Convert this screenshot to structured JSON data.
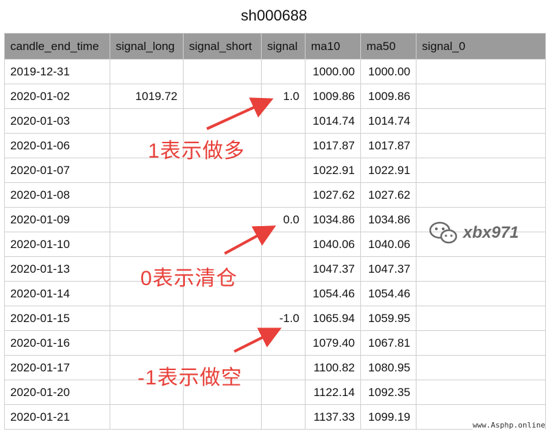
{
  "title": "sh000688",
  "columns": [
    "candle_end_time",
    "signal_long",
    "signal_short",
    "signal",
    "ma10",
    "ma50",
    "signal_0"
  ],
  "rows": [
    [
      "2019-12-31",
      "",
      "",
      "",
      "1000.00",
      "1000.00",
      ""
    ],
    [
      "2020-01-02",
      "1019.72",
      "",
      "1.0",
      "1009.86",
      "1009.86",
      ""
    ],
    [
      "2020-01-03",
      "",
      "",
      "",
      "1014.74",
      "1014.74",
      ""
    ],
    [
      "2020-01-06",
      "",
      "",
      "",
      "1017.87",
      "1017.87",
      ""
    ],
    [
      "2020-01-07",
      "",
      "",
      "",
      "1022.91",
      "1022.91",
      ""
    ],
    [
      "2020-01-08",
      "",
      "",
      "",
      "1027.62",
      "1027.62",
      ""
    ],
    [
      "2020-01-09",
      "",
      "",
      "0.0",
      "1034.86",
      "1034.86",
      ""
    ],
    [
      "2020-01-10",
      "",
      "",
      "",
      "1040.06",
      "1040.06",
      ""
    ],
    [
      "2020-01-13",
      "",
      "",
      "",
      "1047.37",
      "1047.37",
      ""
    ],
    [
      "2020-01-14",
      "",
      "",
      "",
      "1054.46",
      "1054.46",
      ""
    ],
    [
      "2020-01-15",
      "",
      "",
      "-1.0",
      "1065.94",
      "1059.95",
      ""
    ],
    [
      "2020-01-16",
      "",
      "",
      "",
      "1079.40",
      "1067.81",
      ""
    ],
    [
      "2020-01-17",
      "",
      "",
      "",
      "1100.82",
      "1080.95",
      ""
    ],
    [
      "2020-01-20",
      "",
      "",
      "",
      "1122.14",
      "1092.35",
      ""
    ],
    [
      "2020-01-21",
      "",
      "",
      "",
      "1137.33",
      "1099.19",
      ""
    ]
  ],
  "annotations": {
    "long": "1表示做多",
    "flat": "0表示清仓",
    "short": "-1表示做空"
  },
  "watermark": {
    "text": "xbx971",
    "icon": "wechat-icon"
  },
  "site_mark": "www.Asphp.online",
  "colors": {
    "annotation": "#e8403a",
    "header_bg": "#9b9b9b",
    "grid": "#cfcfcf"
  }
}
